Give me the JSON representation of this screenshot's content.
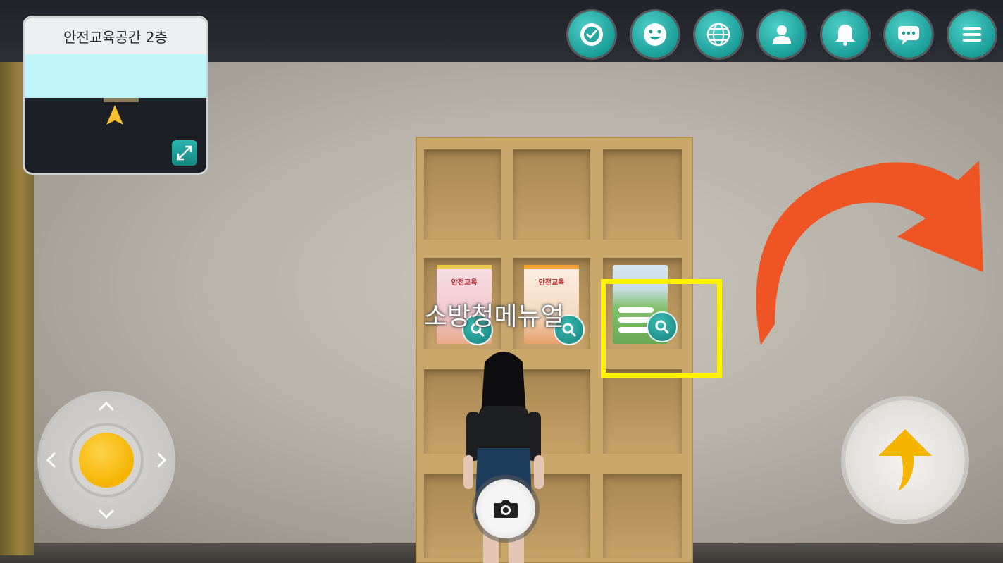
{
  "minimap": {
    "title": "안전교육공간 2층",
    "expand_icon": "expand-icon",
    "player_marker_icon": "player-arrow-icon"
  },
  "top_bar": {
    "buttons": [
      {
        "name": "badge-button",
        "icon": "checkmark-badge-icon"
      },
      {
        "name": "emote-button",
        "icon": "smiley-icon"
      },
      {
        "name": "world-button",
        "icon": "globe-icon"
      },
      {
        "name": "profile-button",
        "icon": "person-icon"
      },
      {
        "name": "notification-button",
        "icon": "bell-icon"
      },
      {
        "name": "chat-button",
        "icon": "speech-bubble-icon"
      },
      {
        "name": "menu-button",
        "icon": "hamburger-menu-icon"
      }
    ]
  },
  "scene": {
    "object_label": "소방청메뉴얼",
    "poster_1_title": "안전교육",
    "poster_2_title": "안전교육",
    "highlight_color": "#fff200",
    "arrow_color": "#ee5424"
  },
  "controls": {
    "joystick_knob_color": "#f4b400",
    "jump_arrow_color": "#f4b400",
    "camera_icon": "camera-icon"
  }
}
